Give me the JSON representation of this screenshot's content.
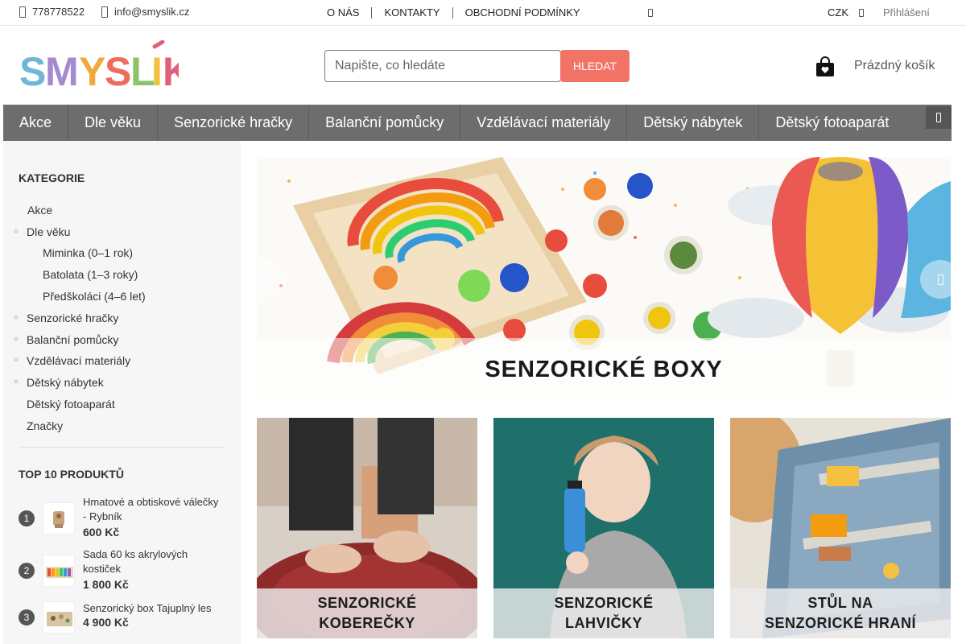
{
  "topbar": {
    "phone": "778778522",
    "email": "info@smyslik.cz",
    "links": [
      "O NÁS",
      "KONTAKTY",
      "OBCHODNÍ PODMÍNKY"
    ],
    "currency": "CZK",
    "login": "Přihlášení"
  },
  "header": {
    "logo_text": "SMYSLÍK",
    "search_placeholder": "Napište, co hledáte",
    "search_button": "HLEDAT",
    "cart_label": "Prázdný košík"
  },
  "nav": {
    "items": [
      "Akce",
      "Dle věku",
      "Senzorické hračky",
      "Balanční pomůcky",
      "Vzdělávací materiály",
      "Dětský nábytek",
      "Dětský fotoaparát"
    ]
  },
  "sidebar": {
    "categories_title": "KATEGORIE",
    "categories": [
      {
        "label": "Akce"
      },
      {
        "label": "Dle věku"
      },
      {
        "label": "Miminka (0–1 rok)"
      },
      {
        "label": "Batolata (1–3 roky)"
      },
      {
        "label": "Předškoláci (4–6 let)"
      },
      {
        "label": "Senzorické hračky"
      },
      {
        "label": "Balanční pomůcky"
      },
      {
        "label": "Vzdělávací materiály"
      },
      {
        "label": "Dětský nábytek"
      },
      {
        "label": "Dětský fotoaparát"
      },
      {
        "label": "Značky"
      }
    ],
    "top_title": "TOP 10 PRODUKTŮ",
    "top_products": [
      {
        "rank": "1",
        "name": "Hmatové a obtiskové válečky - Rybník",
        "price": "600 Kč"
      },
      {
        "rank": "2",
        "name": "Sada 60 ks akrylových kostiček",
        "price": "1 800 Kč"
      },
      {
        "rank": "3",
        "name": "Senzorický box Tajuplný les",
        "price": "4 900 Kč"
      }
    ]
  },
  "banner": {
    "caption": "SENZORICKÉ BOXY"
  },
  "tiles": [
    {
      "line1": "SENZORICKÉ",
      "line2": "KOBEREČKY"
    },
    {
      "line1": "SENZORICKÉ",
      "line2": "LAHVIČKY"
    },
    {
      "line1": "STŮL NA",
      "line2": "SENZORICKÉ HRANÍ"
    }
  ]
}
